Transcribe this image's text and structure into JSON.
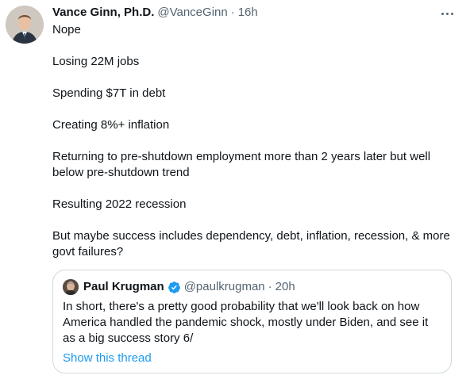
{
  "tweet": {
    "author_name": "Vance Ginn, Ph.D.",
    "author_handle": "@VanceGinn",
    "separator": "·",
    "time": "16h",
    "more_icon": "more-horizontal-icon",
    "paragraphs": [
      "Nope",
      "Losing 22M jobs",
      "Spending $7T in debt",
      "Creating 8%+ inflation",
      "Returning to pre-shutdown employment more than 2 years later but well below pre-shutdown trend",
      "Resulting 2022 recession",
      "But maybe success includes dependency, debt, inflation, recession, & more govt failures?"
    ]
  },
  "quoted_tweet": {
    "author_name": "Paul Krugman",
    "verified_icon": "verified-badge-icon",
    "author_handle": "@paulkrugman",
    "separator": "·",
    "time": "20h",
    "text": "In short, there's a pretty good probability that we'll look back on how America handled the pandemic shock, mostly under Biden, and see it as a big success story 6/",
    "thread_link": "Show this thread"
  },
  "colors": {
    "text_primary": "#0f1419",
    "text_secondary": "#536471",
    "link": "#1d9bf0",
    "verified": "#1d9bf0",
    "border": "#cfd9de"
  }
}
